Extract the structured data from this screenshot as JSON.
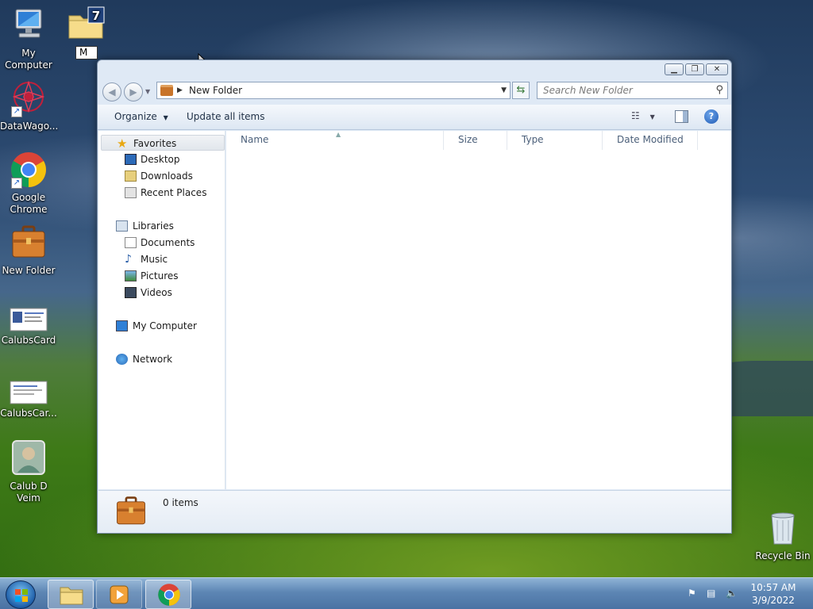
{
  "desktop": {
    "icons": [
      {
        "label": "My Computer"
      },
      {
        "label": "DataWago..."
      },
      {
        "label": "Google Chrome"
      },
      {
        "label": "New Folder"
      },
      {
        "label": "CalubsCard"
      },
      {
        "label": "CalubsCar..."
      },
      {
        "label": "Calub D Veim"
      },
      {
        "label": "Recycle Bin"
      }
    ],
    "rename_value": "M",
    "folder_badge": "7"
  },
  "window": {
    "address_path": "New Folder",
    "search_placeholder": "Search New Folder",
    "toolbar": {
      "organize_label": "Organize",
      "update_label": "Update all items"
    },
    "nav": {
      "favorites": "Favorites",
      "desktop": "Desktop",
      "downloads": "Downloads",
      "recent": "Recent Places",
      "libraries": "Libraries",
      "documents": "Documents",
      "music": "Music",
      "pictures": "Pictures",
      "videos": "Videos",
      "computer": "My Computer",
      "network": "Network"
    },
    "columns": [
      "Name",
      "Size",
      "Type",
      "Date Modified"
    ],
    "status": "0 items"
  },
  "taskbar": {
    "time": "10:57 AM",
    "date": "3/9/2022"
  },
  "colors": {
    "accent": "#1f5ab5",
    "folder": "#c8742a"
  }
}
